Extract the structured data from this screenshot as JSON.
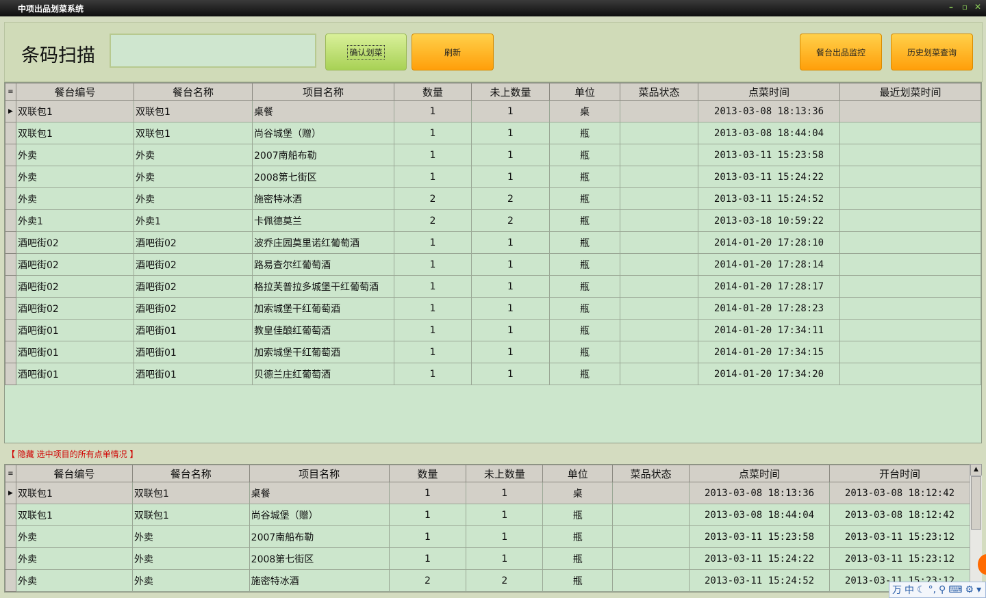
{
  "window": {
    "title": "中项出品划菜系统",
    "controls": [
      "–",
      "▫",
      "✕"
    ]
  },
  "toolbar": {
    "scan_label": "条码扫描",
    "scan_value": "",
    "confirm_button": "确认划菜",
    "refresh_button": "刷新",
    "monitor_button": "餐台出品监控",
    "history_button": "历史划菜查询"
  },
  "grid_top": {
    "columns": [
      "餐台编号",
      "餐台名称",
      "项目名称",
      "数量",
      "未上数量",
      "单位",
      "菜品状态",
      "点菜时间",
      "最近划菜时间"
    ],
    "rows": [
      [
        "双联包1",
        "双联包1",
        "桌餐",
        "1",
        "1",
        "桌",
        "",
        "2013-03-08 18:13:36",
        ""
      ],
      [
        "双联包1",
        "双联包1",
        "尚谷城堡（赠）",
        "1",
        "1",
        "瓶",
        "",
        "2013-03-08 18:44:04",
        ""
      ],
      [
        "外卖",
        "外卖",
        "2007南船布勒",
        "1",
        "1",
        "瓶",
        "",
        "2013-03-11 15:23:58",
        ""
      ],
      [
        "外卖",
        "外卖",
        "2008第七街区",
        "1",
        "1",
        "瓶",
        "",
        "2013-03-11 15:24:22",
        ""
      ],
      [
        "外卖",
        "外卖",
        "施密特冰酒",
        "2",
        "2",
        "瓶",
        "",
        "2013-03-11 15:24:52",
        ""
      ],
      [
        "外卖1",
        "外卖1",
        "卡佩德莫兰",
        "2",
        "2",
        "瓶",
        "",
        "2013-03-18 10:59:22",
        ""
      ],
      [
        "酒吧街02",
        "酒吧街02",
        "波乔庄园莫里诺红葡萄酒",
        "1",
        "1",
        "瓶",
        "",
        "2014-01-20 17:28:10",
        ""
      ],
      [
        "酒吧街02",
        "酒吧街02",
        "路易查尔红葡萄酒",
        "1",
        "1",
        "瓶",
        "",
        "2014-01-20 17:28:14",
        ""
      ],
      [
        "酒吧街02",
        "酒吧街02",
        "格拉芙普拉多城堡干红葡萄酒",
        "1",
        "1",
        "瓶",
        "",
        "2014-01-20 17:28:17",
        ""
      ],
      [
        "酒吧街02",
        "酒吧街02",
        "加索城堡干红葡萄酒",
        "1",
        "1",
        "瓶",
        "",
        "2014-01-20 17:28:23",
        ""
      ],
      [
        "酒吧街01",
        "酒吧街01",
        "教皇佳酿红葡萄酒",
        "1",
        "1",
        "瓶",
        "",
        "2014-01-20 17:34:11",
        ""
      ],
      [
        "酒吧街01",
        "酒吧街01",
        "加索城堡干红葡萄酒",
        "1",
        "1",
        "瓶",
        "",
        "2014-01-20 17:34:15",
        ""
      ],
      [
        "酒吧街01",
        "酒吧街01",
        "贝德兰庄红葡萄酒",
        "1",
        "1",
        "瓶",
        "",
        "2014-01-20 17:34:20",
        ""
      ]
    ]
  },
  "hint_text": "【 隐藏 选中项目的所有点单情况 】",
  "grid_bottom": {
    "columns": [
      "餐台编号",
      "餐台名称",
      "项目名称",
      "数量",
      "未上数量",
      "单位",
      "菜品状态",
      "点菜时间",
      "开台时间"
    ],
    "rows": [
      [
        "双联包1",
        "双联包1",
        "桌餐",
        "1",
        "1",
        "桌",
        "",
        "2013-03-08 18:13:36",
        "2013-03-08 18:12:42"
      ],
      [
        "双联包1",
        "双联包1",
        "尚谷城堡（赠）",
        "1",
        "1",
        "瓶",
        "",
        "2013-03-08 18:44:04",
        "2013-03-08 18:12:42"
      ],
      [
        "外卖",
        "外卖",
        "2007南船布勒",
        "1",
        "1",
        "瓶",
        "",
        "2013-03-11 15:23:58",
        "2013-03-11 15:23:12"
      ],
      [
        "外卖",
        "外卖",
        "2008第七街区",
        "1",
        "1",
        "瓶",
        "",
        "2013-03-11 15:24:22",
        "2013-03-11 15:23:12"
      ],
      [
        "外卖",
        "外卖",
        "施密特冰酒",
        "2",
        "2",
        "瓶",
        "",
        "2013-03-11 15:24:52",
        "2013-03-11 15:23:12"
      ]
    ]
  },
  "ime_bar": {
    "items": [
      "万",
      "中",
      "☾",
      "°,",
      "⚲",
      "⌨",
      "⚙",
      "▾"
    ]
  }
}
